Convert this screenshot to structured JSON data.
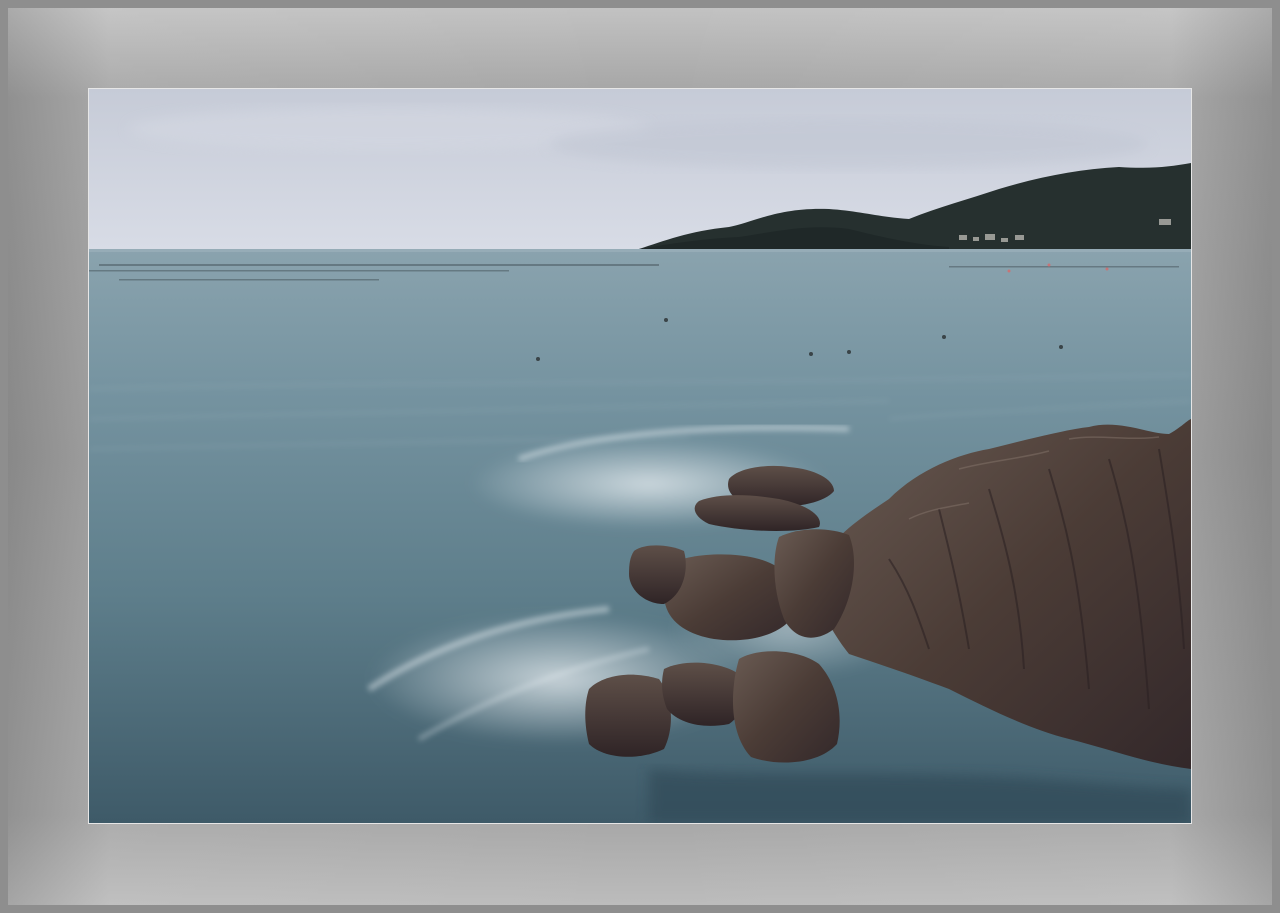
{
  "photo": {
    "colors": {
      "frame": "#8e8e8e",
      "mat": "#a4a4a4",
      "sky_top": "#c7ccd8",
      "sky_bottom": "#d6dbe5",
      "sea_far": "#7e9aa6",
      "sea_mid": "#5f7f8c",
      "sea_near": "#3f5d6b",
      "hills": "#2b3533",
      "rocks": "#4a3b35",
      "rocks_light": "#6b5a51",
      "foam": "#e8eef2"
    }
  }
}
